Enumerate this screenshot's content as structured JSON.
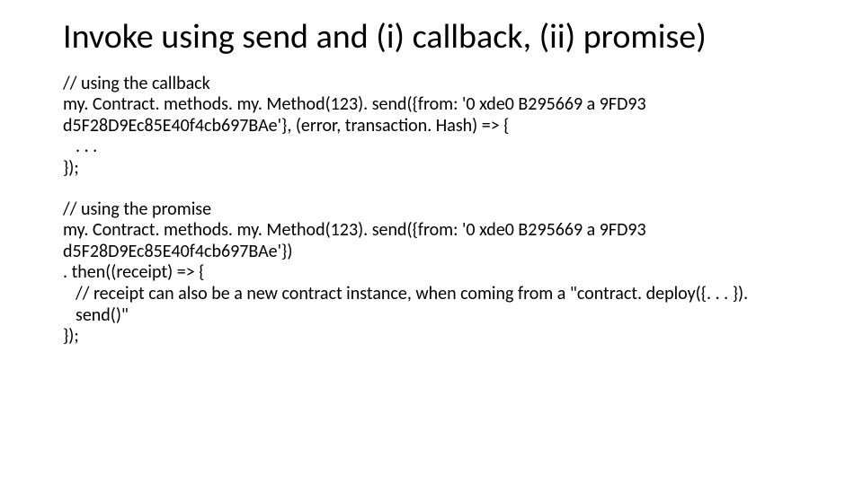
{
  "title": "Invoke using send and (i) callback, (ii) promise)",
  "block1": {
    "l1": "// using the callback",
    "l2": "my. Contract. methods. my. Method(123). send({from: '0 xde0 B295669 a 9FD93 d5F28D9Ec85E40f4cb697BAe'}, (error, transaction. Hash) => {",
    "l3": ". . .",
    "l4": "});"
  },
  "block2": {
    "l1": "// using the promise",
    "l2": "my. Contract. methods. my. Method(123). send({from: '0 xde0 B295669 a 9FD93 d5F28D9Ec85E40f4cb697BAe'})",
    "l3": ". then((receipt) => {",
    "l4": "// receipt can also be a new contract instance, when coming from a \"contract. deploy({. . . }). send()\"",
    "l5": "});"
  }
}
